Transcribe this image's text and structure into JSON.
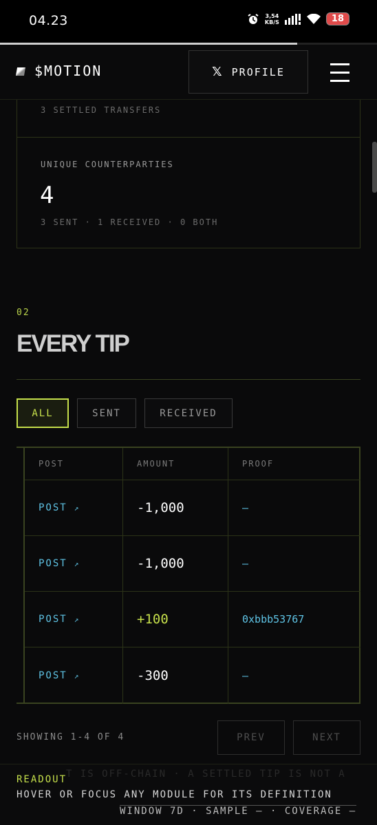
{
  "status_bar": {
    "time": "04.23",
    "net_speed_value": "3,54",
    "net_speed_unit": "KB/S",
    "battery": "18"
  },
  "header": {
    "logo": "$MOTION",
    "profile_button": "PROFILE",
    "x_glyph": "𝕏"
  },
  "cards": {
    "settled_transfers": "3 SETTLED TRANSFERS",
    "counterparties_label": "UNIQUE COUNTERPARTIES",
    "counterparties_value": "4",
    "counterparties_breakdown": "3 SENT · 1 RECEIVED · 0 BOTH"
  },
  "section": {
    "number": "02",
    "title": "EVERY TIP"
  },
  "filters": [
    "ALL",
    "SENT",
    "RECEIVED"
  ],
  "active_filter": "ALL",
  "table": {
    "headers": [
      "POST",
      "AMOUNT",
      "PROOF"
    ],
    "rows": [
      {
        "post": "POST",
        "arrow": "↗",
        "amount": "-1,000",
        "proof": "—"
      },
      {
        "post": "POST",
        "arrow": "↗",
        "amount": "-1,000",
        "proof": "—"
      },
      {
        "post": "POST",
        "arrow": "↗",
        "amount": "+100",
        "proof": "0xbbb53767"
      },
      {
        "post": "POST",
        "arrow": "↗",
        "amount": "-300",
        "proof": "—"
      }
    ]
  },
  "pagination": {
    "showing": "SHOWING 1-4 OF 4",
    "prev": "PREV",
    "next": "NEXT"
  },
  "readout": {
    "ghost_text": "T IS OFF-CHAIN · A SETTLED TIP IS NOT A",
    "label": "READOUT",
    "text": "HOVER OR FOCUS ANY MODULE FOR ITS DEFINITION",
    "footer": "WINDOW 7D · SAMPLE — · COVERAGE —"
  },
  "colors": {
    "accent": "#c6e04b",
    "link": "#5fc4e6",
    "border": "#2c3318",
    "bg": "#0a0a0b"
  }
}
